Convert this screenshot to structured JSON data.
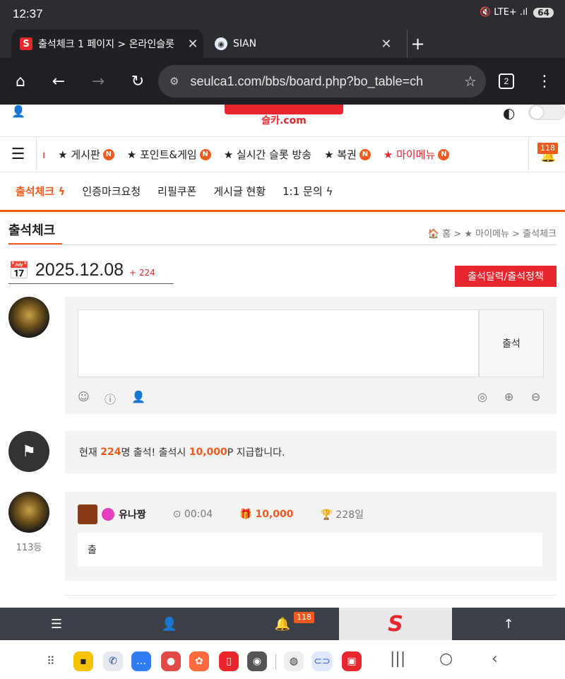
{
  "status": {
    "time": "12:37",
    "icons": "🔇 LTE+ .ıl",
    "battery": "64"
  },
  "tabs": [
    {
      "title": "출석체크 1 페이지 > 온라인슬롯",
      "close": "✕"
    },
    {
      "title": "SIAN",
      "close": "✕"
    }
  ],
  "newtab": "+",
  "toolbar": {
    "url": "seulca1.com/bbs/board.php?bo_table=ch",
    "tabcount": "2"
  },
  "site": {
    "logo_sub": "슬카.com"
  },
  "mainnav": {
    "items": [
      {
        "label": "★ 게시판",
        "badge": "N"
      },
      {
        "label": "★ 포인트&게임",
        "badge": "N"
      },
      {
        "label": "★ 실시간 슬롯 방송",
        "badge": ""
      },
      {
        "label": "★ 복권",
        "badge": "N"
      },
      {
        "label": "★ 마이메뉴",
        "badge": "N"
      }
    ],
    "bell_count": "118"
  },
  "subnav": [
    "출석체크",
    "인증마크요청",
    "리필쿠폰",
    "게시글 현황",
    "1:1 문의"
  ],
  "page": {
    "title": "출석체크",
    "breadcrumb": "홈 > ★ 마이메뉴 > 출석체크",
    "date": "2025.12.08",
    "date_plus": "+ 224",
    "calendar_button": "출석달력/출석정책"
  },
  "comment": {
    "submit": "출석"
  },
  "notice": {
    "pre": "현재 ",
    "count": "224",
    "mid": "명 출석! 출석시 ",
    "points": "10,000",
    "post": "P 지급합니다."
  },
  "entry": {
    "name": "유나짱",
    "time": "00:04",
    "points": "10,000",
    "days": "228일",
    "rank": "113등",
    "message": "출"
  },
  "bottombar": {
    "bell_count": "118",
    "logo": "S"
  }
}
